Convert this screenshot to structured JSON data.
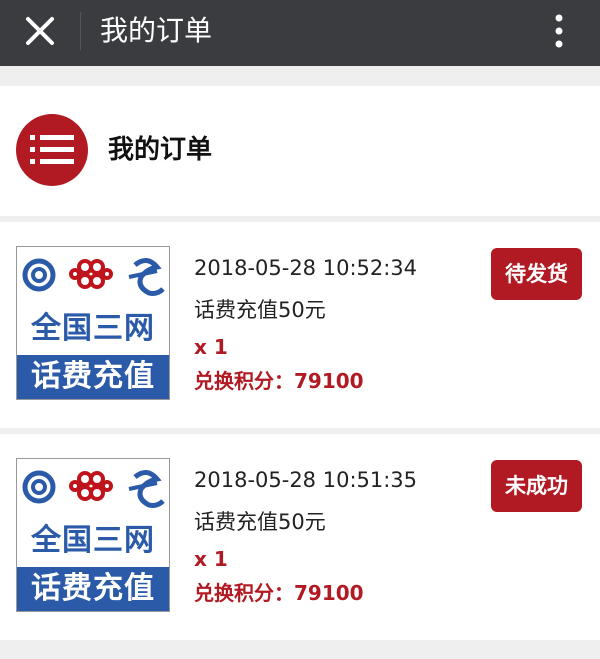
{
  "topbar": {
    "title": "我的订单",
    "close_icon": "close-icon",
    "more_icon": "more-vertical-icon"
  },
  "header": {
    "title": "我的订单",
    "icon": "list-icon"
  },
  "colors": {
    "brand_red": "#b11a22",
    "topbar_bg": "#3b3c40",
    "thumb_blue": "#2a5aa8"
  },
  "orders": [
    {
      "thumbnail": {
        "line1": "全国三网",
        "line2": "话费充值"
      },
      "datetime": "2018-05-28 10:52:34",
      "name": "话费充值50元",
      "qty": "x 1",
      "points": "兑换积分：79100",
      "status": "待发货"
    },
    {
      "thumbnail": {
        "line1": "全国三网",
        "line2": "话费充值"
      },
      "datetime": "2018-05-28 10:51:35",
      "name": "话费充值50元",
      "qty": "x 1",
      "points": "兑换积分：79100",
      "status": "未成功"
    }
  ]
}
